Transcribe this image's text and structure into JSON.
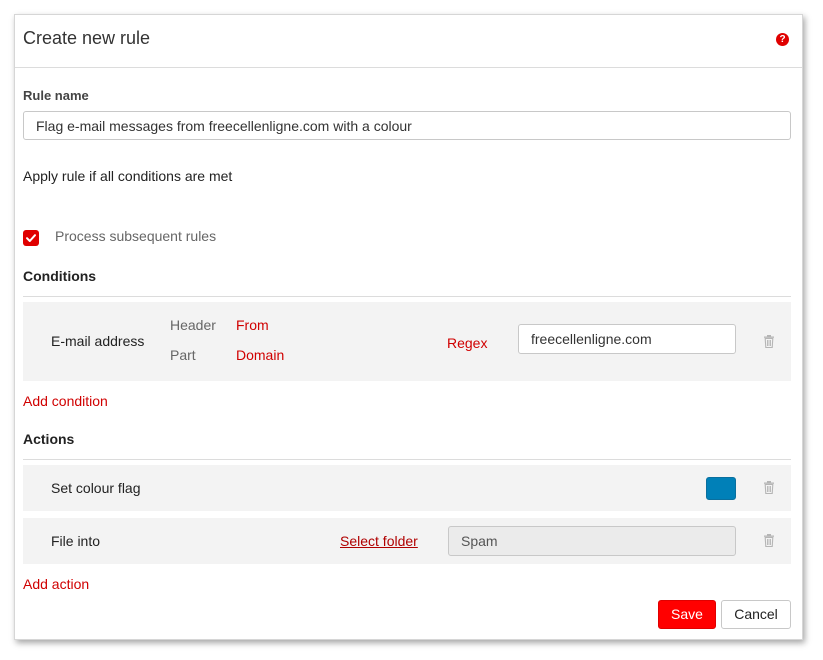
{
  "dialog": {
    "title": "Create new rule",
    "help_icon": "?"
  },
  "rule_name": {
    "label": "Rule name",
    "value": "Flag e-mail messages from freecellenligne.com with a colour"
  },
  "apply_text": "Apply rule if all conditions are met",
  "process_subsequent": {
    "checked": true,
    "label": "Process subsequent rules"
  },
  "conditions": {
    "title": "Conditions",
    "items": [
      {
        "type": "E-mail address",
        "header_label": "Header",
        "header_value": "From",
        "part_label": "Part",
        "part_value": "Domain",
        "operator": "Regex",
        "value": "freecellenligne.com"
      }
    ],
    "add_label": "Add condition"
  },
  "actions": {
    "title": "Actions",
    "items": [
      {
        "label": "Set colour flag",
        "color": "#0080b8"
      },
      {
        "label": "File into",
        "select_folder": "Select folder",
        "folder": "Spam"
      }
    ],
    "add_label": "Add action"
  },
  "buttons": {
    "save": "Save",
    "cancel": "Cancel"
  },
  "colors": {
    "accent": "#e00000",
    "save_button": "#ff0000",
    "row_background": "#f3f3f3"
  }
}
